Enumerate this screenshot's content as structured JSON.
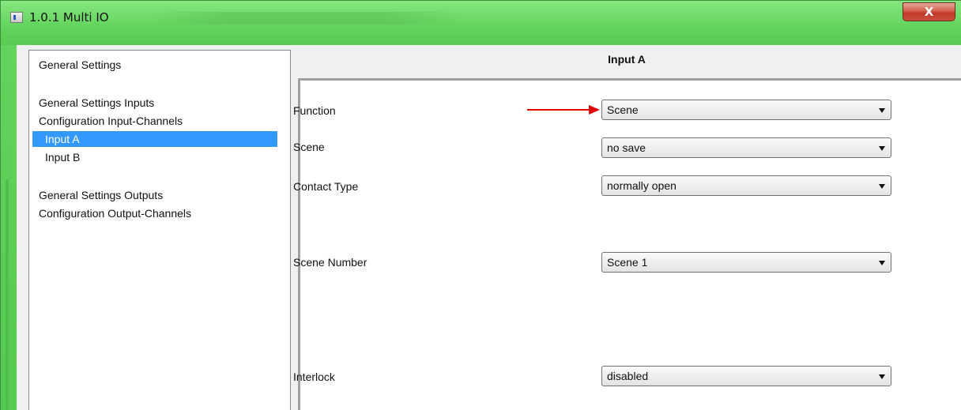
{
  "window": {
    "title": "1.0.1 Multi IO",
    "close_label": "X",
    "icon": "app-window-icon"
  },
  "tree": {
    "items": [
      {
        "label": "General Settings",
        "selected": false
      },
      {
        "label": "General Settings Inputs",
        "selected": false
      },
      {
        "label": "Configuration Input-Channels",
        "selected": false
      },
      {
        "label": "Input  A",
        "selected": true
      },
      {
        "label": "Input  B",
        "selected": false
      },
      {
        "label": "General Settings Outputs",
        "selected": false
      },
      {
        "label": "Configuration Output-Channels",
        "selected": false
      }
    ]
  },
  "panel": {
    "title": "Input  A",
    "params": [
      {
        "label": "Function",
        "value": "Scene"
      },
      {
        "label": "Scene",
        "value": "no save"
      },
      {
        "label": "Contact Type",
        "value": "normally open"
      },
      {
        "label": "Scene Number",
        "value": "Scene  1"
      },
      {
        "label": "Interlock",
        "value": "disabled"
      }
    ]
  },
  "colors": {
    "titlebar": "#62d35c",
    "selection": "#3399ff",
    "annotation_arrow": "#e00000",
    "close_button": "#c0392b"
  }
}
